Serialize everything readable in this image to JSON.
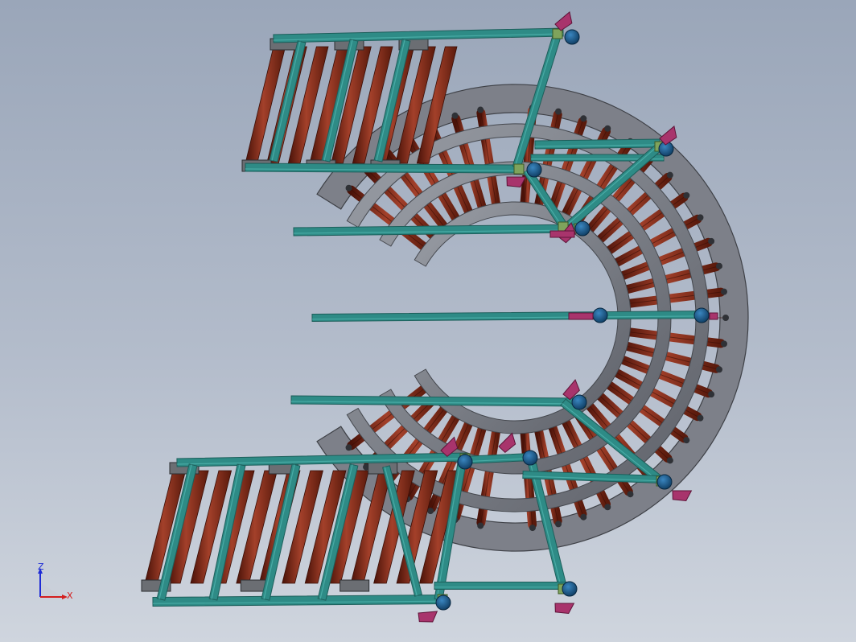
{
  "viewport": {
    "background_top": "#9aa6b9",
    "background_bottom": "#cfd5de"
  },
  "model": {
    "frame_color": "#2e8b86",
    "frame_dark": "#1d5f5b",
    "roller_color": "#7a2414",
    "roller_highlight": "#b24a2a",
    "rail_color": "#8a8d95",
    "rail_dark": "#5c5f66",
    "foot_color": "#1a5a8c",
    "bracket_color": "#a8346c",
    "plate_color": "#6b6e73"
  },
  "triad": {
    "z_label": "Z",
    "x_label": "X",
    "z_color": "#1e2bd6",
    "x_color": "#d41e1e"
  }
}
